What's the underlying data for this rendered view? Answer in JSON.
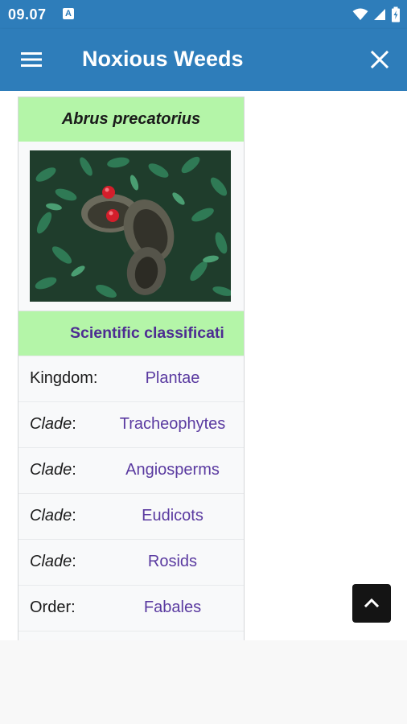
{
  "status_bar": {
    "time": "09.07",
    "notification_letter": "A"
  },
  "app_bar": {
    "title": "Noxious Weeds"
  },
  "infobox": {
    "title": "Abrus precatorius",
    "image_alt": "Abrus precatorius seed pods with red seeds",
    "classification_header": "Scientific classificati",
    "ranks": [
      {
        "label": "Kingdom:",
        "italic": false,
        "value": "Plantae"
      },
      {
        "label": "Clade",
        "suffix": ":",
        "italic": true,
        "value": "Tracheophytes"
      },
      {
        "label": "Clade",
        "suffix": ":",
        "italic": true,
        "value": "Angiosperms"
      },
      {
        "label": "Clade",
        "suffix": ":",
        "italic": true,
        "value": "Eudicots"
      },
      {
        "label": "Clade",
        "suffix": ":",
        "italic": true,
        "value": "Rosids"
      },
      {
        "label": "Order:",
        "italic": false,
        "value": "Fabales"
      }
    ]
  },
  "colors": {
    "primary": "#2e7dba",
    "infobox_header": "#b4f5a8",
    "link": "#5a3aa0",
    "scroll_button": "#141414"
  },
  "icons": {
    "menu": "hamburger-icon",
    "close": "close-icon",
    "scroll_top": "chevron-up-icon",
    "wifi": "wifi-icon",
    "signal": "signal-icon",
    "battery": "battery-icon"
  }
}
